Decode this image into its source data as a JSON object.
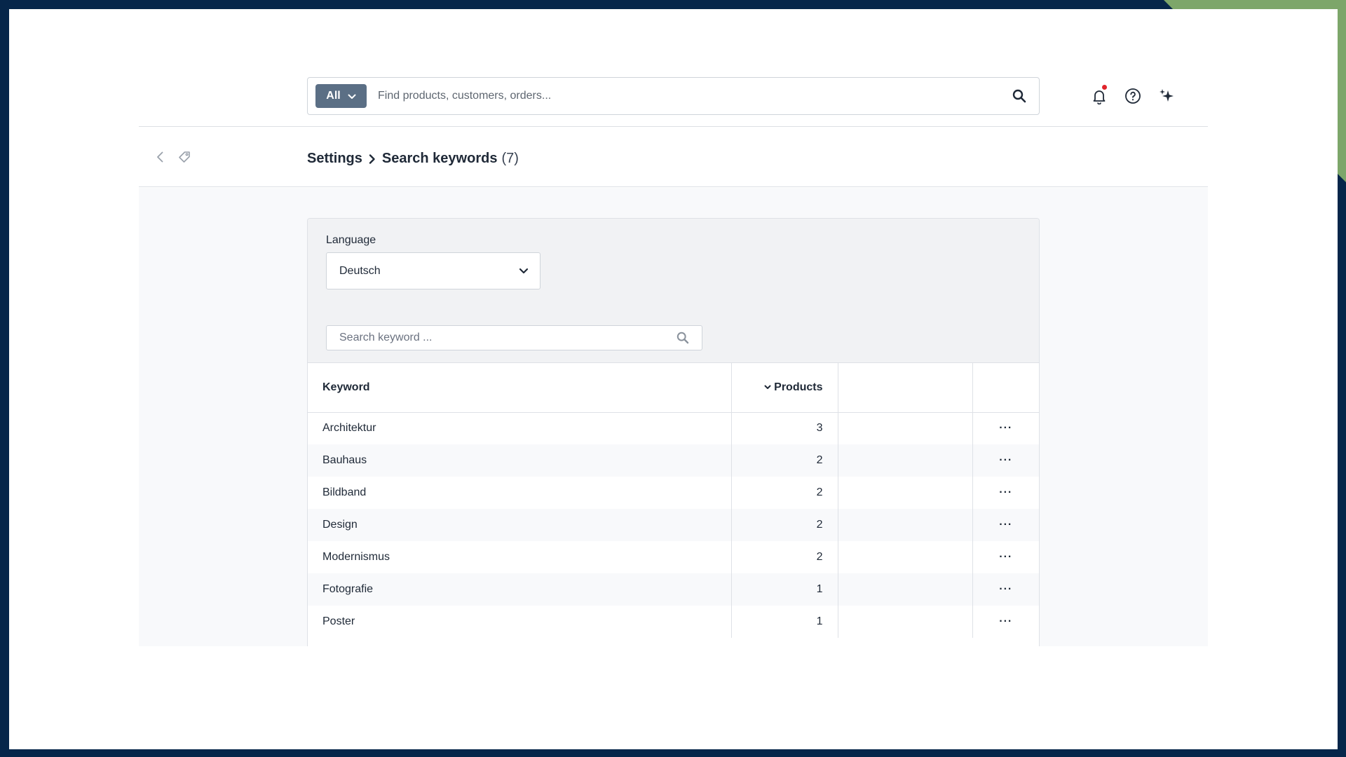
{
  "topbar": {
    "scope_label": "All",
    "search_placeholder": "Find products, customers, orders..."
  },
  "header": {
    "breadcrumb_parent": "Settings",
    "breadcrumb_current": "Search keywords",
    "count": "(7)"
  },
  "filters": {
    "language_label": "Language",
    "language_value": "Deutsch",
    "keyword_search_placeholder": "Search keyword ..."
  },
  "table": {
    "columns": {
      "keyword": "Keyword",
      "products": "Products"
    },
    "rows": [
      {
        "keyword": "Architektur",
        "products": "3"
      },
      {
        "keyword": "Bauhaus",
        "products": "2"
      },
      {
        "keyword": "Bildband",
        "products": "2"
      },
      {
        "keyword": "Design",
        "products": "2"
      },
      {
        "keyword": "Modernismus",
        "products": "2"
      },
      {
        "keyword": "Fotografie",
        "products": "1"
      },
      {
        "keyword": "Poster",
        "products": "1"
      }
    ],
    "row_action_label": "···"
  },
  "icons": {
    "scope": "chevron-down-icon",
    "search": "search-icon",
    "notifications": "bell-icon",
    "help": "help-circle-icon",
    "ai": "sparkles-icon",
    "back": "chevron-left-icon",
    "tag": "tag-icon"
  },
  "colors": {
    "frame": "#06264a",
    "frame_accent": "#7da66a",
    "scope_button": "#5b6f85",
    "notification_dot": "#e0242b"
  }
}
